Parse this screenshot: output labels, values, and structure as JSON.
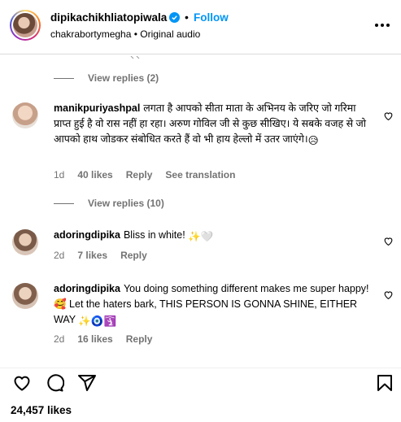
{
  "post": {
    "author": "dipikachikhliatopiwala",
    "follow_label": "Follow",
    "separator": "•",
    "subline": "chakrabortymegha • Original audio"
  },
  "threads": [
    {
      "view_replies": "View replies (2)"
    },
    {
      "view_replies": "View replies (10)"
    }
  ],
  "comments": [
    {
      "user": "manikpuriyashpal",
      "text": "लगता है आपको सीता माता के अभिनय के जरिए जो गरिमा प्राप्त हुई है वो रास नहीं हा रहा। अरुण गोविल जी से कुछ सीखिए। ये सबके वजह से जो आपको हाथ जोडकर संबोधित करते हैं वो भी हाय हेल्लो में उतर जाएंगे।",
      "emoji": "😥",
      "time": "1d",
      "likes": "40 likes",
      "reply": "Reply",
      "translate": "See translation"
    },
    {
      "user": "adoringdipika",
      "text": "Bliss in white!",
      "emoji": "✨🤍",
      "time": "2d",
      "likes": "7 likes",
      "reply": "Reply"
    },
    {
      "user": "adoringdipika",
      "text": "You doing something different makes me super happy! 🥰 Let the haters bark, THIS PERSON IS GONNA SHINE, EITHER WAY",
      "emoji": "✨🧿🛐",
      "time": "2d",
      "likes": "16 likes",
      "reply": "Reply"
    }
  ],
  "footer": {
    "likes": "24,457 likes"
  },
  "colors": {
    "accent": "#0095f6",
    "muted": "#737373",
    "divider": "#dbdbdb"
  },
  "icons": [
    "verified-icon",
    "more-options-icon",
    "heart-icon",
    "comment-icon",
    "share-icon",
    "bookmark-icon"
  ]
}
